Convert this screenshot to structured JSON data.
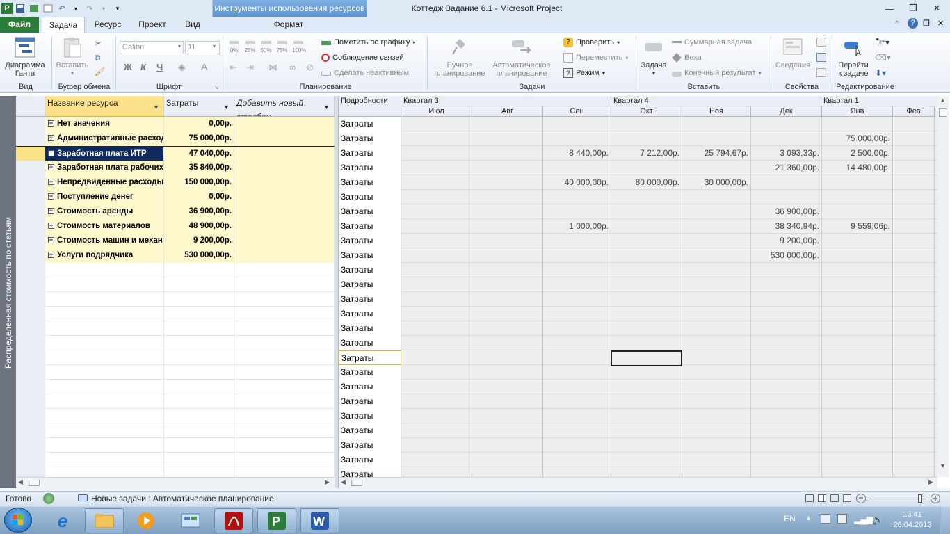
{
  "titlebar": {
    "context_tab": "Инструменты использования ресурсов",
    "window_title": "Коттедж Задание 6.1  -  Microsoft Project"
  },
  "tabs": {
    "file": "Файл",
    "task": "Задача",
    "resource": "Ресурс",
    "project": "Проект",
    "view": "Вид",
    "format": "Формат"
  },
  "ribbon": {
    "view": {
      "gantt": "Диаграмма",
      "gantt2": "Ганта",
      "label": "Вид"
    },
    "clipboard": {
      "paste": "Вставить",
      "label": "Буфер обмена"
    },
    "font": {
      "family": "Calibri",
      "size": "11",
      "bold": "Ж",
      "italic": "К",
      "underline": "Ч",
      "label": "Шрифт"
    },
    "schedule": {
      "pcts": [
        "0%",
        "25%",
        "50%",
        "75%",
        "100%"
      ],
      "mark_on_track": "Пометить по графику",
      "respect_links": "Соблюдение связей",
      "inactivate": "Сделать неактивным",
      "label": "Планирование"
    },
    "tasks": {
      "manual": "Ручное",
      "manual2": "планирование",
      "auto": "Автоматическое",
      "auto2": "планирование",
      "inspect": "Проверить",
      "move": "Переместить",
      "mode": "Режим",
      "label": "Задачи"
    },
    "insert": {
      "task": "Задача",
      "summary": "Суммарная задача",
      "milestone": "Веха",
      "deliverable": "Конечный результат",
      "label": "Вставить"
    },
    "properties": {
      "info": "Сведения",
      "label": "Свойства"
    },
    "editing": {
      "goto": "Перейти",
      "goto2": "к задаче",
      "label": "Редактирование"
    }
  },
  "sidebar_label": "Распределенная стоимость по статьям",
  "left_table": {
    "headers": [
      "Название ресурса",
      "Затраты",
      "Добавить новый столбец"
    ],
    "rows": [
      {
        "name": "Нет значения",
        "cost": "0,00р."
      },
      {
        "name": "Административные расходы",
        "cost": "75 000,00р."
      },
      {
        "name": "Заработная плата ИТР",
        "cost": "47 040,00р."
      },
      {
        "name": "Заработная плата рабочих",
        "cost": "35 840,00р."
      },
      {
        "name": "Непредвиденные расходы",
        "cost": "150 000,00р."
      },
      {
        "name": "Поступление денег",
        "cost": "0,00р."
      },
      {
        "name": "Стоимость аренды",
        "cost": "36 900,00р."
      },
      {
        "name": "Стоимость материалов",
        "cost": "48 900,00р."
      },
      {
        "name": "Стоимость машин и механизмов",
        "cost": "9 200,00р."
      },
      {
        "name": "Услуги подрядчика",
        "cost": "530 000,00р."
      }
    ]
  },
  "right_table": {
    "details_header": "Подробности",
    "quarters": [
      "Квартал 3",
      "Квартал 4",
      "Квартал 1"
    ],
    "months": [
      "Июл",
      "Авг",
      "Сен",
      "Окт",
      "Ноя",
      "Дек",
      "Янв",
      "Фев"
    ],
    "detail_label": "Затраты",
    "rows": [
      [
        "",
        "",
        "",
        "",
        "",
        "",
        "",
        ""
      ],
      [
        "",
        "",
        "",
        "",
        "",
        "",
        "75 000,00р.",
        ""
      ],
      [
        "",
        "",
        "8 440,00р.",
        "7 212,00р.",
        "25 794,67р.",
        "3 093,33р.",
        "2 500,00р.",
        ""
      ],
      [
        "",
        "",
        "",
        "",
        "",
        "21 360,00р.",
        "14 480,00р.",
        ""
      ],
      [
        "",
        "",
        "40 000,00р.",
        "80 000,00р.",
        "30 000,00р.",
        "",
        "",
        ""
      ],
      [
        "",
        "",
        "",
        "",
        "",
        "",
        "",
        ""
      ],
      [
        "",
        "",
        "",
        "",
        "",
        "36 900,00р.",
        "",
        ""
      ],
      [
        "",
        "",
        "1 000,00р.",
        "",
        "",
        "38 340,94р.",
        "9 559,06р.",
        ""
      ],
      [
        "",
        "",
        "",
        "",
        "",
        "9 200,00р.",
        "",
        ""
      ],
      [
        "",
        "",
        "",
        "",
        "",
        "530 000,00р.",
        "",
        ""
      ]
    ]
  },
  "statusbar": {
    "ready": "Готово",
    "new_tasks": "Новые задачи : Автоматическое планирование"
  },
  "taskbar": {
    "lang": "EN",
    "time": "13:41",
    "date": "26.04.2013"
  }
}
